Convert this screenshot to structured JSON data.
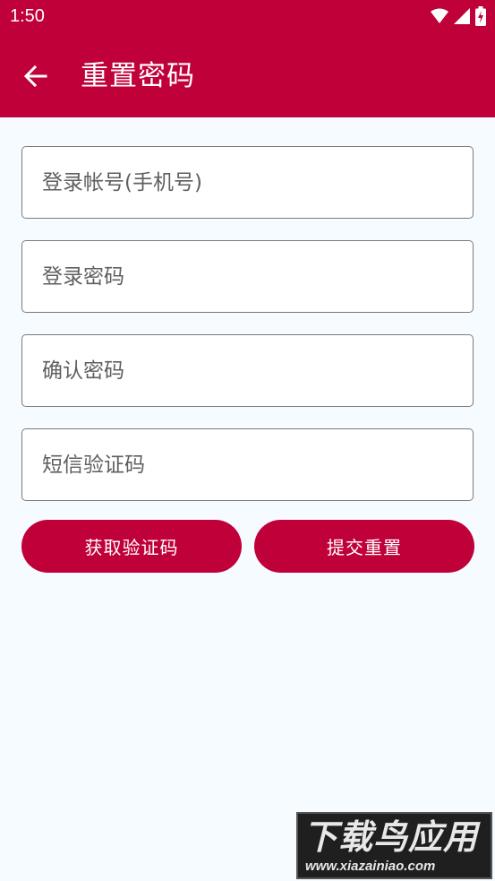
{
  "status_bar": {
    "time": "1:50",
    "icons": [
      "wifi-icon",
      "signal-icon",
      "battery-charging-icon"
    ]
  },
  "app_bar": {
    "back_icon": "arrow-left-icon",
    "title": "重置密码"
  },
  "form": {
    "account": {
      "value": "",
      "placeholder": "登录帐号(手机号)"
    },
    "password": {
      "value": "",
      "placeholder": "登录密码"
    },
    "confirm_password": {
      "value": "",
      "placeholder": "确认密码"
    },
    "sms_code": {
      "value": "",
      "placeholder": "短信验证码"
    }
  },
  "actions": {
    "get_code_label": "获取验证码",
    "submit_label": "提交重置"
  },
  "watermark": {
    "title": "下载鸟应用",
    "url": "www.xiazainiao.com"
  },
  "colors": {
    "primary": "#c00039",
    "background": "#f6fbff",
    "border": "#7a7a7a"
  }
}
